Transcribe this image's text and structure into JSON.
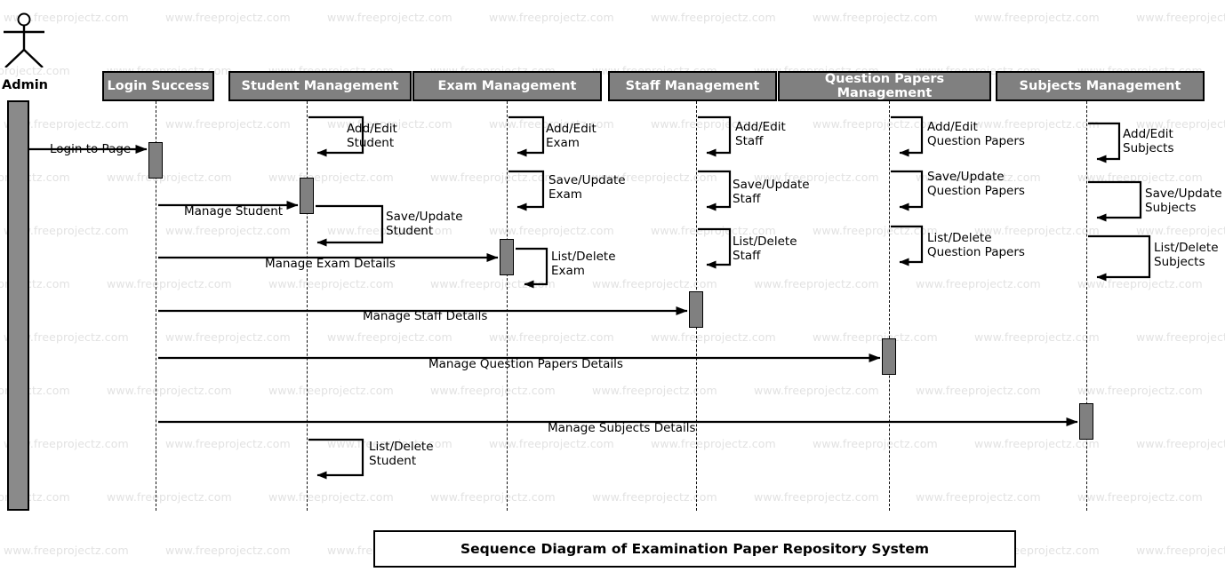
{
  "diagram": {
    "caption": "Sequence Diagram of Examination Paper Repository System",
    "watermark_text": "www.freeprojectz.com",
    "colors": {
      "header_fill": "#808080",
      "activation_fill": "#808080",
      "stroke": "#000000",
      "header_text": "#ffffff",
      "watermark": "#e2e2e2",
      "background": "#ffffff"
    }
  },
  "actor": {
    "label": "Admin"
  },
  "lifelines": [
    {
      "id": "login",
      "label": "Login Success"
    },
    {
      "id": "student",
      "label": "Student Management"
    },
    {
      "id": "exam",
      "label": "Exam Management"
    },
    {
      "id": "staff",
      "label": "Staff Management"
    },
    {
      "id": "question",
      "label": "Question Papers Management"
    },
    {
      "id": "subjects",
      "label": "Subjects Management"
    }
  ],
  "messages": [
    {
      "id": "m1",
      "label": "Login to Page",
      "from": "actor",
      "to": "login",
      "kind": "call"
    },
    {
      "id": "m2",
      "label": "Manage Student",
      "from": "actor",
      "to": "student",
      "kind": "call"
    },
    {
      "id": "m3",
      "label": "Manage Exam Details",
      "from": "actor",
      "to": "exam",
      "kind": "call"
    },
    {
      "id": "m4",
      "label": "Manage Staff Details",
      "from": "actor",
      "to": "staff",
      "kind": "call"
    },
    {
      "id": "m5",
      "label": "Manage Question Papers Details",
      "from": "actor",
      "to": "question",
      "kind": "call"
    },
    {
      "id": "m6",
      "label": "Manage Subjects Details",
      "from": "actor",
      "to": "subjects",
      "kind": "call"
    }
  ],
  "self_messages": [
    {
      "id": "s1",
      "lifeline": "student",
      "line1": "Add/Edit",
      "line2": "Student"
    },
    {
      "id": "s2",
      "lifeline": "student",
      "line1": "Save/Update",
      "line2": "Student"
    },
    {
      "id": "s3",
      "lifeline": "student",
      "line1": "List/Delete",
      "line2": "Student"
    },
    {
      "id": "s4",
      "lifeline": "exam",
      "line1": "Add/Edit",
      "line2": "Exam"
    },
    {
      "id": "s5",
      "lifeline": "exam",
      "line1": "Save/Update",
      "line2": "Exam"
    },
    {
      "id": "s6",
      "lifeline": "exam",
      "line1": "List/Delete",
      "line2": "Exam"
    },
    {
      "id": "s7",
      "lifeline": "staff",
      "line1": "Add/Edit",
      "line2": "Staff"
    },
    {
      "id": "s8",
      "lifeline": "staff",
      "line1": "Save/Update",
      "line2": "Staff"
    },
    {
      "id": "s9",
      "lifeline": "staff",
      "line1": "List/Delete",
      "line2": "Staff"
    },
    {
      "id": "s10",
      "lifeline": "question",
      "line1": "Add/Edit",
      "line2": "Question Papers"
    },
    {
      "id": "s11",
      "lifeline": "question",
      "line1": "Save/Update",
      "line2": "Question Papers"
    },
    {
      "id": "s12",
      "lifeline": "question",
      "line1": "List/Delete",
      "line2": "Question Papers"
    },
    {
      "id": "s13",
      "lifeline": "subjects",
      "line1": "Add/Edit",
      "line2": "Subjects"
    },
    {
      "id": "s14",
      "lifeline": "subjects",
      "line1": "Save/Update",
      "line2": "Subjects"
    },
    {
      "id": "s15",
      "lifeline": "subjects",
      "line1": "List/Delete",
      "line2": "Subjects"
    }
  ]
}
